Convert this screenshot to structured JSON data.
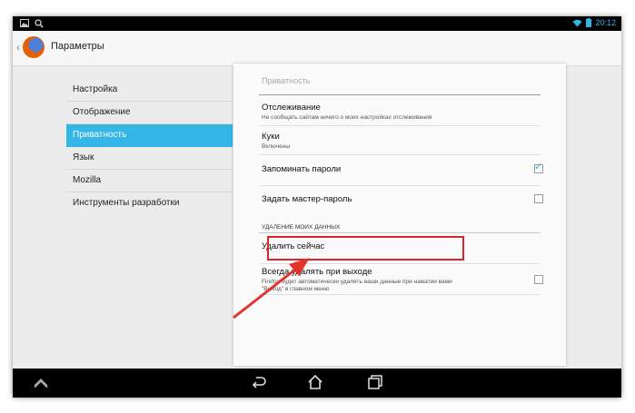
{
  "app": {
    "title": "Параметры"
  },
  "status": {
    "time": "20:12"
  },
  "sidebar": {
    "items": [
      {
        "label": "Настройка"
      },
      {
        "label": "Отображение"
      },
      {
        "label": "Приватность"
      },
      {
        "label": "Язык"
      },
      {
        "label": "Mozilla"
      },
      {
        "label": "Инструменты разработки"
      }
    ],
    "active_index": 2
  },
  "panel": {
    "title": "Приватность",
    "prefs": {
      "tracking": {
        "title": "Отслеживание",
        "summary": "Не сообщать сайтам ничего о моих настройках отслеживания"
      },
      "cookies": {
        "title": "Куки",
        "summary": "Включены"
      },
      "remember_passwords": {
        "title": "Запоминать пароли",
        "checked": true
      },
      "master_password": {
        "title": "Задать мастер-пароль",
        "checked": false
      }
    },
    "section_header": "УДАЛЕНИЕ МОИХ ДАННЫХ",
    "clear_now": {
      "title": "Удалить сейчас"
    },
    "clear_on_exit": {
      "title": "Всегда удалять при выходе",
      "summary_line1": "Firefox будет автоматически удалять ваши данные при нажатии вами",
      "summary_line2": "\"Выход\" в главном меню",
      "checked": false
    }
  },
  "colors": {
    "accent": "#33b5e5",
    "highlight": "#d9232d"
  },
  "icons": {
    "status_left": [
      "image-icon",
      "search-icon"
    ],
    "status_right": [
      "wifi-icon",
      "battery-icon"
    ],
    "nav": [
      "recents-up-icon",
      "back-icon",
      "home-icon",
      "recent-apps-icon"
    ]
  }
}
